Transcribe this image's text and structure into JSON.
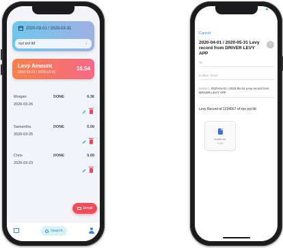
{
  "left_app": {
    "date_range": "2020-03-01 / 2020-03-31",
    "company": "xyz pvt ltd",
    "levy": {
      "title": "Levy Amount",
      "range": "2020-03-01 / 2020-03-31",
      "amount": "16.54"
    },
    "records": [
      {
        "name": "Morgan",
        "status": "DONE",
        "amount": "6.36",
        "date": "2020-03-26"
      },
      {
        "name": "Samantha",
        "status": "DONE",
        "amount": "5.09",
        "date": "2020-03-25"
      },
      {
        "name": "Chris",
        "status": "DONE",
        "amount": "5.09",
        "date": "2020-03-23"
      }
    ],
    "email_label": "Email",
    "search_label": "Search",
    "colors": {
      "accent": "#3a82d8",
      "danger": "#ee4d5a",
      "levy_start": "#f7814e",
      "levy_end": "#f56886"
    }
  },
  "right_app": {
    "cancel_label": "Cancel",
    "subject_title": "2020-04-01 / 2020-05-31 Levy record from DRIVER LEVY APP",
    "to_label": "To:",
    "cc_label": "Cc/Bcc, From:",
    "subject_label": "Subject:",
    "subject_value": "2020-04-01 / 2020-05-31 Levy record from DRIVER LEVY APP",
    "body": "Levy Record of 1234567 of xyz pvt ltd",
    "attachment": {
      "name": "levyfile.csv",
      "size": "3 KB"
    },
    "colors": {
      "link": "#2f7ff0"
    }
  }
}
